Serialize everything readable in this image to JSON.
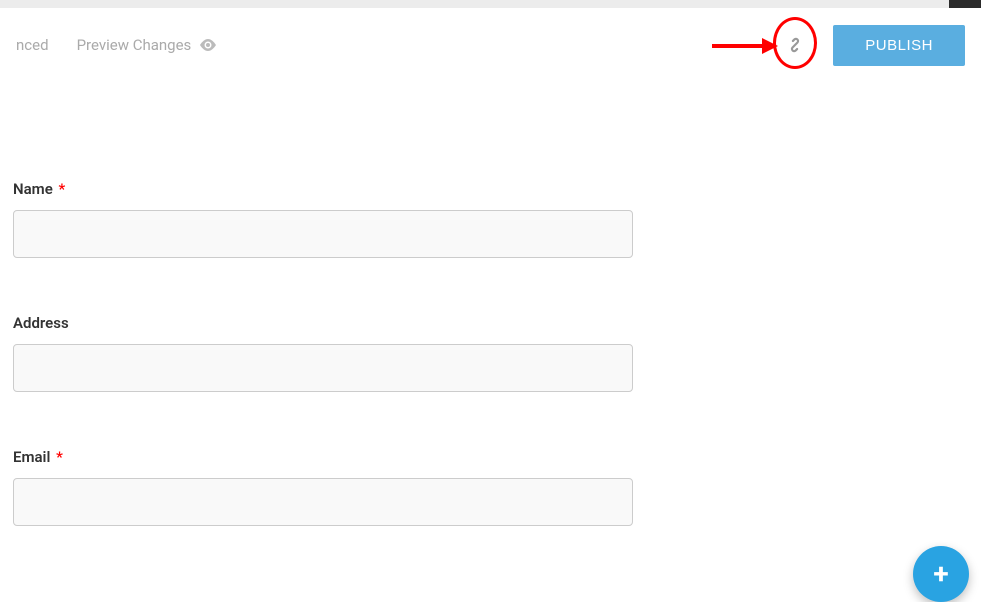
{
  "header": {
    "tab_partial": "nced",
    "preview_label": "Preview Changes",
    "publish_label": "PUBLISH"
  },
  "form": {
    "fields": [
      {
        "label": "Name",
        "required": true
      },
      {
        "label": "Address",
        "required": false
      },
      {
        "label": "Email",
        "required": true
      }
    ]
  },
  "required_marker": "*"
}
